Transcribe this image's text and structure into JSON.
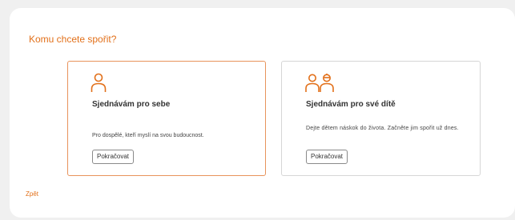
{
  "question": "Komu chcete spořit?",
  "options": [
    {
      "title": "Sjednávám pro sebe",
      "description": "Pro dospělé, kteří myslí na svou budoucnost.",
      "button": "Pokračovat",
      "icon": "person-icon",
      "selected": true
    },
    {
      "title": "Sjednávám pro své dítě",
      "description": "Dejte dětem náskok do života. Začněte jim spořit už dnes.",
      "button": "Pokračovat",
      "icon": "parent-and-child-icon",
      "selected": false
    }
  ],
  "back": "Zpět",
  "colors": {
    "accent": "#e2701a",
    "selected_border": "#e8935b",
    "card_border": "#d6d6d6",
    "background": "#f0f0f0"
  }
}
